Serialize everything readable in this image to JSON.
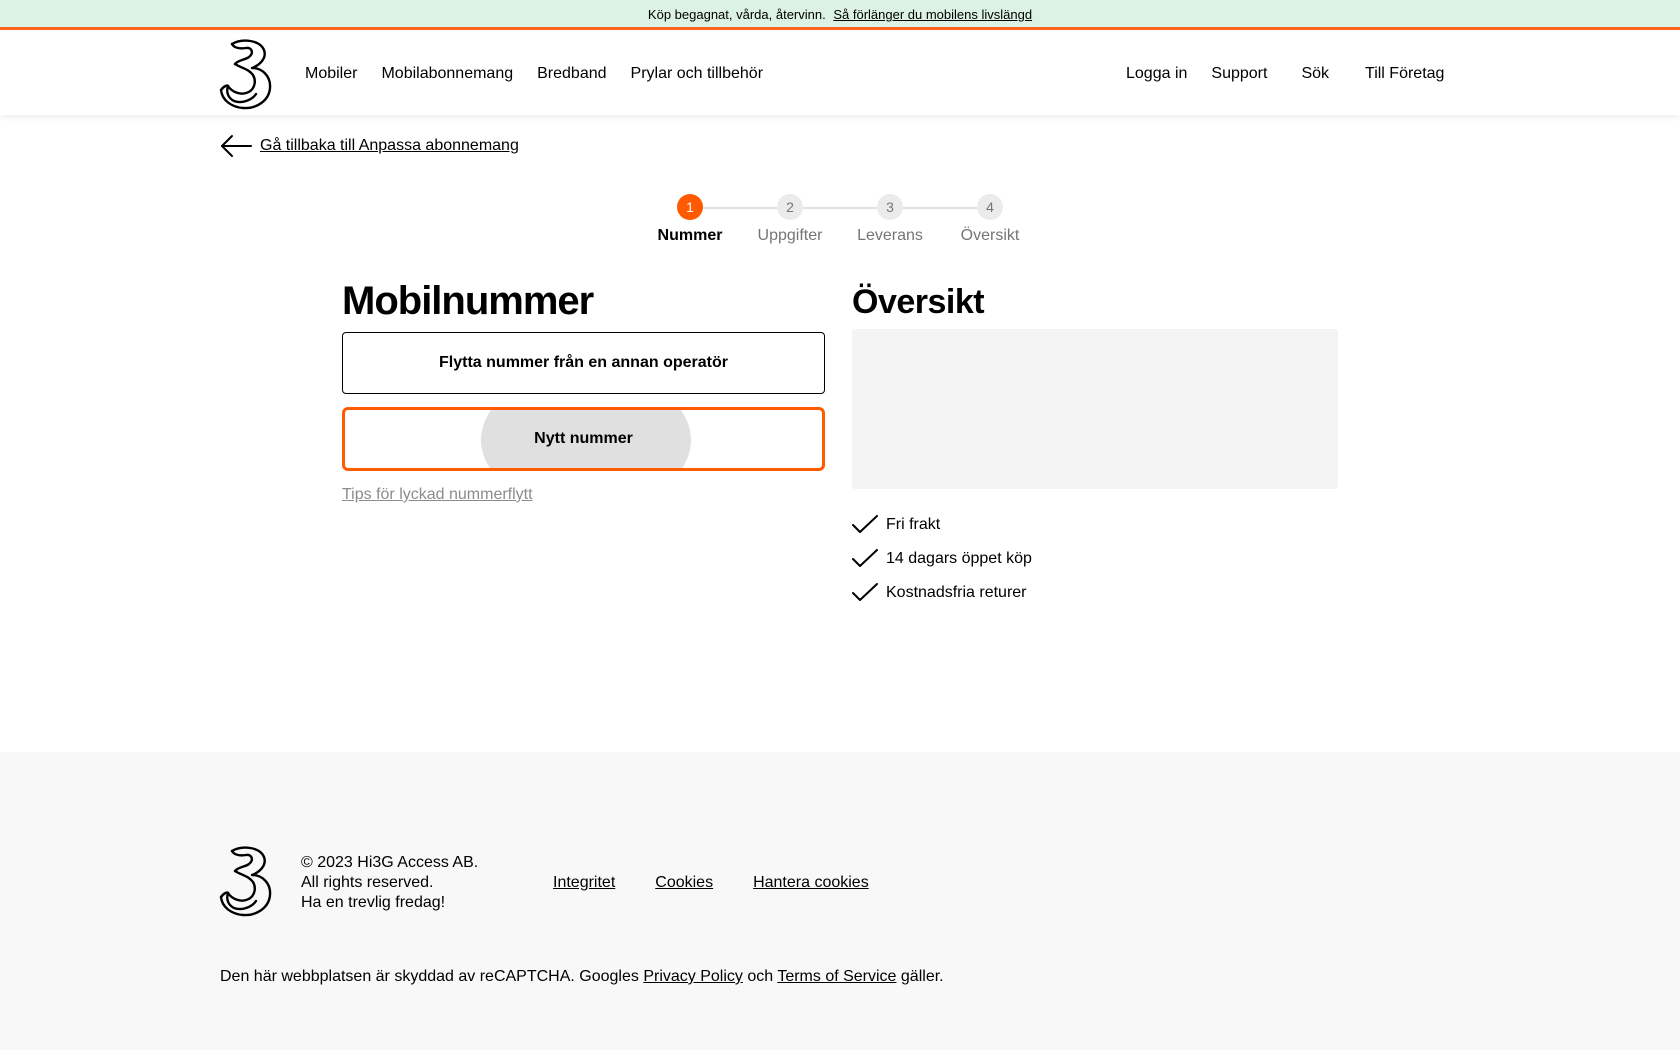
{
  "promo": {
    "text": "Köp begagnat, vårda, återvinn.",
    "link": "Så förlänger du mobilens livslängd"
  },
  "header": {
    "nav_main": [
      "Mobiler",
      "Mobilabonnemang",
      "Bredband",
      "Prylar och tillbehör"
    ],
    "nav_right": [
      "Logga in",
      "Support",
      "Sök",
      "Till Företag"
    ]
  },
  "back_link": "Gå tillbaka till Anpassa abonnemang",
  "steps": [
    {
      "number": "1",
      "label": "Nummer"
    },
    {
      "number": "2",
      "label": "Uppgifter"
    },
    {
      "number": "3",
      "label": "Leverans"
    },
    {
      "number": "4",
      "label": "Översikt"
    }
  ],
  "number_section": {
    "title": "Mobilnummer",
    "option_move": "Flytta nummer från en annan operatör",
    "option_new": "Nytt nummer",
    "tips_link": "Tips för lyckad nummerflytt"
  },
  "overview": {
    "title": "Översikt",
    "benefits": [
      "Fri frakt",
      "14 dagars öppet köp",
      "Kostnadsfria returer"
    ]
  },
  "footer": {
    "copyright": [
      "© 2023 Hi3G Access AB.",
      "All rights reserved.",
      "Ha en trevlig fredag!"
    ],
    "links": [
      "Integritet",
      "Cookies",
      "Hantera cookies"
    ],
    "recaptcha": {
      "prefix": "Den här webbplatsen är skyddad av reCAPTCHA. Googles",
      "privacy": "Privacy Policy",
      "and": "och",
      "terms": "Terms of Service",
      "suffix": "gäller."
    }
  },
  "colors": {
    "accent": "#ff5a00",
    "promo_bg": "#dcf2e4"
  },
  "icons": [
    "three-logo-icon",
    "arrow-left-icon",
    "checkmark-icon"
  ]
}
